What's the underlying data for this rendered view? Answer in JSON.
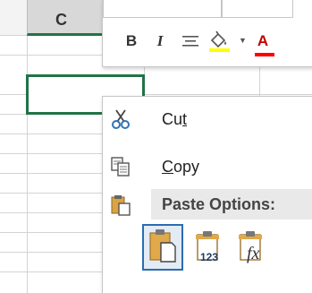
{
  "grid": {
    "column_letter": "C"
  },
  "mini_toolbar": {
    "bold_label": "B",
    "italic_label": "I",
    "font_color_label": "A",
    "colors": {
      "fill_highlight": "#ffff00",
      "font_color": "#ff0000"
    },
    "icons": [
      "align-center-icon",
      "fill-color-icon",
      "dropdown-arrow-icon"
    ]
  },
  "context_menu": {
    "cut": {
      "label_prefix": "Cu",
      "label_accel": "t",
      "icon": "scissors-icon"
    },
    "copy": {
      "label_accel": "C",
      "label_rest": "opy",
      "icon": "copy-icon"
    },
    "paste_options": {
      "label": "Paste Options:",
      "icon": "clipboard-icon"
    },
    "paste_buttons": [
      {
        "name": "paste-default",
        "icon": "paste-icon",
        "selected": true
      },
      {
        "name": "paste-values",
        "icon": "paste-values-icon",
        "text": "123"
      },
      {
        "name": "paste-formulas",
        "icon": "paste-formulas-icon",
        "text": "fx"
      }
    ]
  }
}
